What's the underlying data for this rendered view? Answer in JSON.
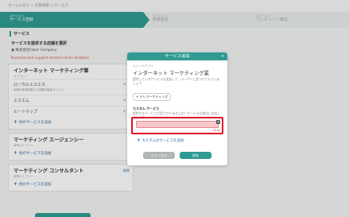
{
  "breadcrumb": "ホームに戻る  >  企業情報 > サービス",
  "steps": [
    {
      "num": "ステップ 1",
      "title": "サービス登録"
    },
    {
      "num": "ステップ 2",
      "title": "目標設定"
    },
    {
      "num": "ステップ 3",
      "title": "プレビュー・確定"
    }
  ],
  "page": {
    "section_title": "サービス",
    "sub_title": "サービスを提供する店舗を選択",
    "company": "株式会社Faber Company",
    "error": "Business and support service not be disabled",
    "cards": [
      {
        "title": "インターネット マーケティング業",
        "caption": "カテゴリー",
        "rows": [
          {
            "name": "ローカルエスエス",
            "desc": "地域の検索結果から店舗の集客サービス"
          },
          {
            "name": "エスエム",
            "desc": ""
          },
          {
            "name": "ヒートマップ",
            "desc": ""
          }
        ],
        "add": "他のサービスを追加"
      },
      {
        "title": "マーケティング エージェンシー",
        "caption": "新規カテゴリー",
        "add": "他のサービスを追加",
        "edit": ""
      },
      {
        "title": "マーケティング コンサルタント",
        "caption": "新規カテゴリー",
        "add": "他のサービスを追加",
        "edit": "削除"
      }
    ]
  },
  "modal": {
    "title": "サービス追加",
    "close": "×",
    "main_label": "メインカテゴリ",
    "main_title": "インターネット マーケティング業",
    "main_desc": "提供しているサービスを追加して、ユーザーに見つけてもらいましょう",
    "tag": "+ テレマーケティング",
    "custom_label": "カスタム サービス",
    "custom_desc": "提供するサービスが見つかりませんか？サービスを独自に作成しましょう",
    "input_value": "",
    "input_count": "0/120",
    "add_custom": "カスタムのサービスを追加",
    "cancel": "キャンセル",
    "save": "保存"
  },
  "colors": {
    "accent": "#2f9b92",
    "error": "#e0102a",
    "link": "#2f6aa7"
  }
}
